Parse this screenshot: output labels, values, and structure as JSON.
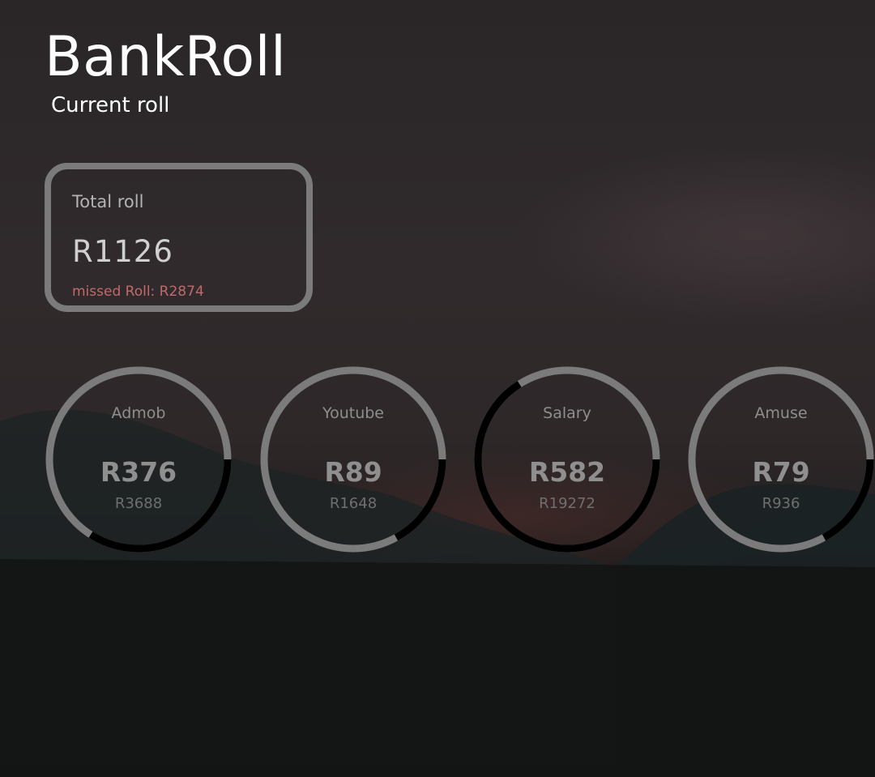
{
  "header": {
    "title": "BankRoll",
    "subtitle": "Current roll"
  },
  "total_card": {
    "label": "Total roll",
    "value": "R1126",
    "missed_label": "missed Roll: R2874"
  },
  "gauges": [
    {
      "name": "Admob",
      "value": "R376",
      "target": "R3688",
      "progress": 0.34
    },
    {
      "name": "Youtube",
      "value": "R89",
      "target": "R1648",
      "progress": 0.17
    },
    {
      "name": "Salary",
      "value": "R582",
      "target": "R19272",
      "progress": 0.66
    },
    {
      "name": "Amuse",
      "value": "R79",
      "target": "R936",
      "progress": 0.17
    }
  ],
  "colors": {
    "ring_track": "#7b7b7b",
    "ring_progress": "#000000",
    "missed_text": "#c06a6a"
  }
}
